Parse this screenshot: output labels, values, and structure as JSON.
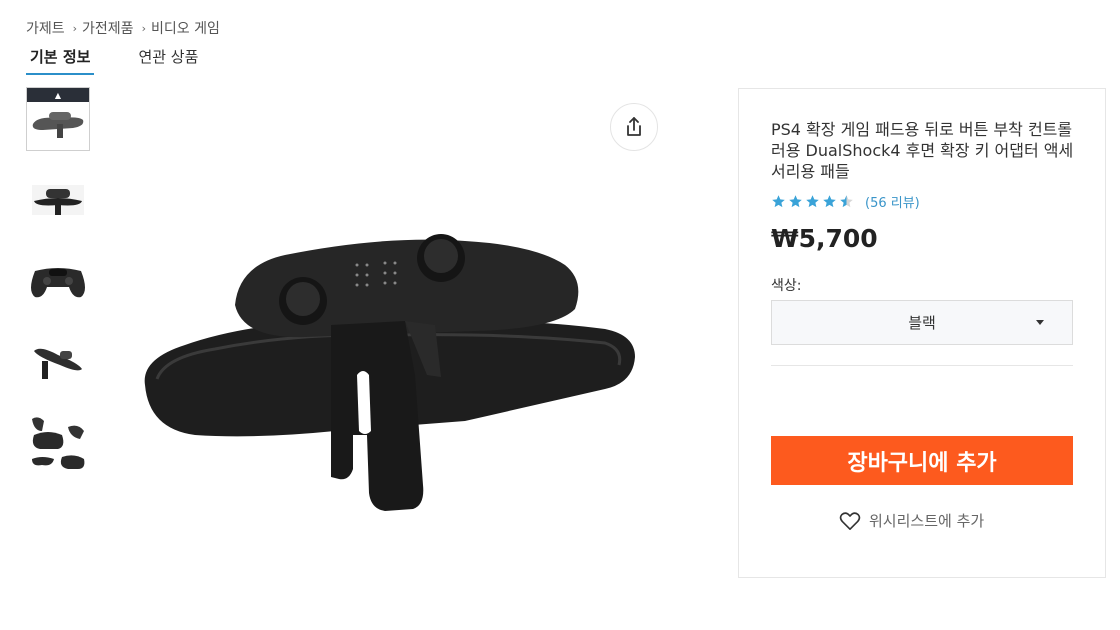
{
  "breadcrumb": [
    "가제트",
    "가전제품",
    "비디오 게임"
  ],
  "tabs": [
    {
      "label": "기본 정보",
      "active": true
    },
    {
      "label": "연관 상품",
      "active": false
    }
  ],
  "thumbnails": [
    {
      "name": "thumb-paddle-top"
    },
    {
      "name": "thumb-paddle-front"
    },
    {
      "name": "thumb-controller-back"
    },
    {
      "name": "thumb-paddle-side"
    },
    {
      "name": "thumb-collage"
    }
  ],
  "icons": {
    "share": "share-icon",
    "star": "star-icon",
    "caret": "chevron-down-icon",
    "heart": "heart-icon"
  },
  "product": {
    "title": "PS4 확장 게임 패드용 뒤로 버튼 부착 컨트롤러용 DualShock4 후면 확장 키 어댑터 액세서리용 패들",
    "rating": 4.5,
    "review_count": "(56 리뷰)",
    "price": "₩5,700",
    "color_label": "색상:",
    "color_selected": "블랙",
    "add_to_cart": "장바구니에 추가",
    "wishlist": "위시리스트에 추가"
  },
  "colors": {
    "accent": "#fd5a1e",
    "tab_underline": "#2b8fc9",
    "star": "#3aa3d8",
    "link": "#3a95c9"
  }
}
